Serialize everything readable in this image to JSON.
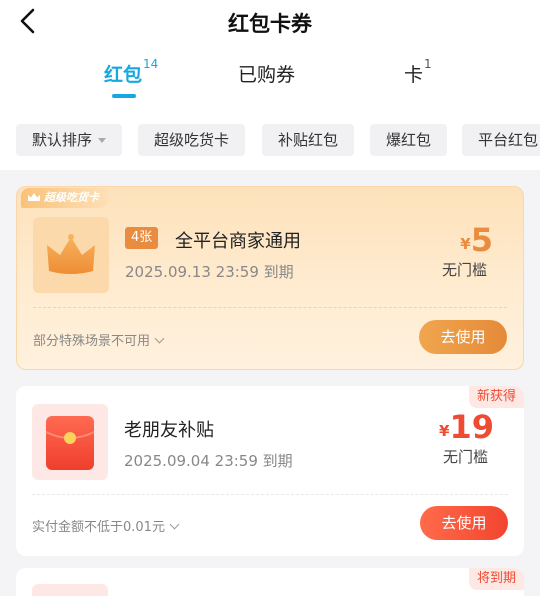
{
  "header": {
    "title": "红包卡券",
    "back_icon": "chevron-left-icon"
  },
  "tabs": [
    {
      "label": "红包",
      "count": "14",
      "active": true
    },
    {
      "label": "已购券",
      "count": "",
      "active": false
    },
    {
      "label": "卡",
      "count": "1",
      "active": false
    }
  ],
  "filters": [
    "默认排序",
    "超级吃货卡",
    "补贴红包",
    "爆红包",
    "平台红包"
  ],
  "coupons": [
    {
      "tag": "超级吃货卡",
      "badge": "4张",
      "title": "全平台商家通用",
      "date": "2025.09.13 23:59 到期",
      "currency": "¥",
      "amount": "5",
      "condition": "无门槛",
      "note": "部分特殊场景不可用",
      "button": "去使用",
      "accent": "#e98c3f"
    },
    {
      "corner": "新获得",
      "title": "老朋友补贴",
      "date": "2025.09.04 23:59 到期",
      "currency": "¥",
      "amount": "19",
      "condition": "无门槛",
      "note": "实付金额不低于0.01元",
      "button": "去使用",
      "accent": "#ef4b32"
    },
    {
      "corner": "将到期"
    }
  ],
  "colors": {
    "brand": "#16a8e0",
    "red": "#ef4b32",
    "gold": "#e98c3f"
  }
}
